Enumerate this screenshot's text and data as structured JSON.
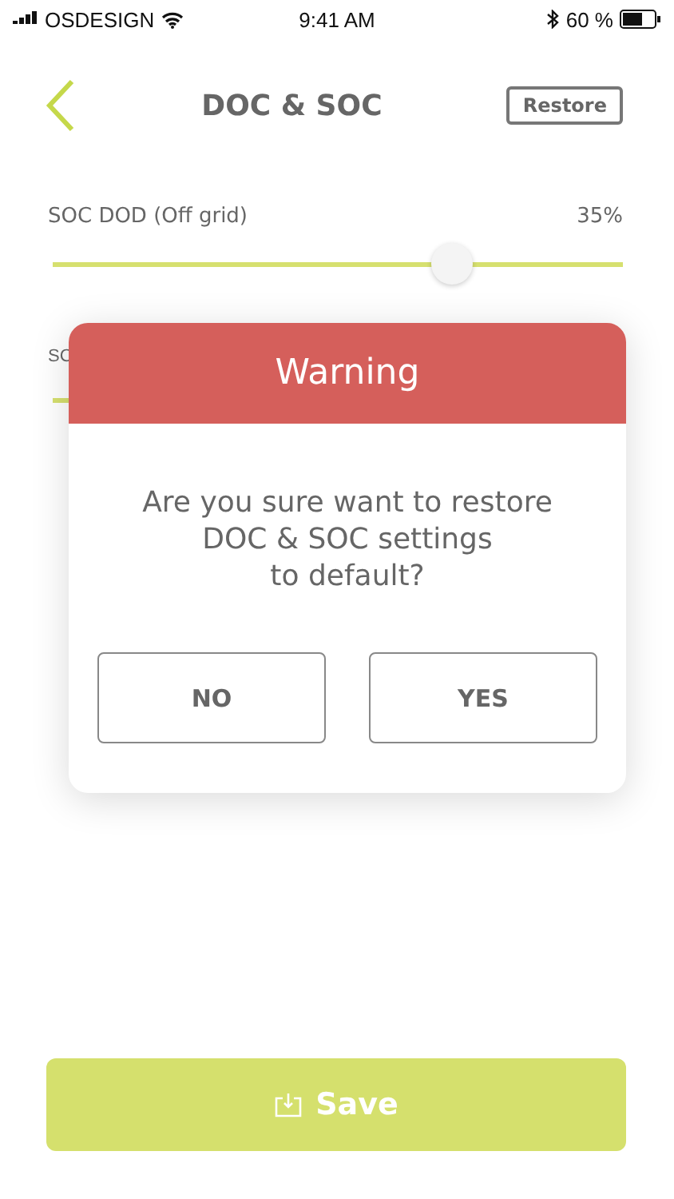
{
  "status_bar": {
    "carrier": "OSDESIGN",
    "time": "9:41 AM",
    "battery": "60 %"
  },
  "header": {
    "title": "DOC & SOC",
    "action": "Restore"
  },
  "sliders": [
    {
      "label": "SOC DOD (Off grid)",
      "reading": "35%",
      "level": 0.7
    },
    {
      "label": "SC"
    }
  ],
  "dialog": {
    "title": "Warning",
    "message": "Are you sure want to restore\nDOC & SOC settings\nto default?",
    "buttons": [
      "NO",
      "YES"
    ]
  },
  "save_button": "Save"
}
